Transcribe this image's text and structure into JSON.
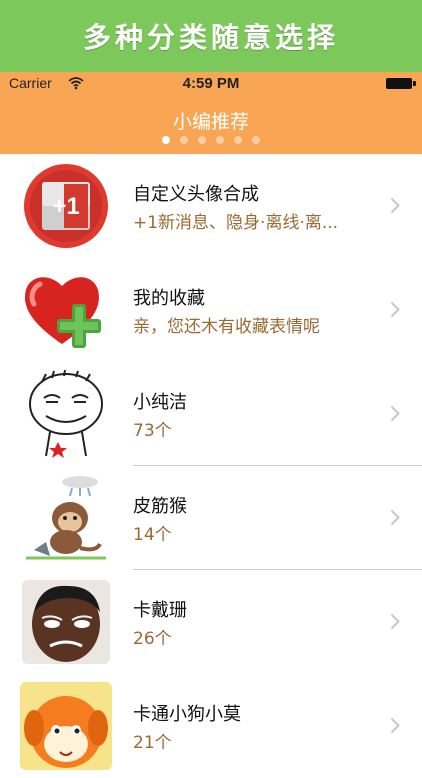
{
  "promo": {
    "text": "多种分类随意选择"
  },
  "status_bar": {
    "carrier": "Carrier",
    "time": "4:59 PM"
  },
  "nav": {
    "title": "小编推荐",
    "page_count": 6,
    "active_page": 1
  },
  "colors": {
    "promo_green": "#7cc85a",
    "header_orange": "#f9a654",
    "subtitle_brown": "#9b6a33"
  },
  "items": [
    {
      "title": "自定义头像合成",
      "subtitle": "+1新消息、隐身·离线·离...",
      "icon": "plus-one-badge-icon",
      "badge": "+1"
    },
    {
      "title": "我的收藏",
      "subtitle": "亲，您还木有收藏表情呢",
      "icon": "heart-plus-icon"
    },
    {
      "title": "小纯洁",
      "subtitle": "73个",
      "icon": "sketch-face-icon"
    },
    {
      "title": "皮筋猴",
      "subtitle": "14个",
      "icon": "monkey-icon"
    },
    {
      "title": "卡戴珊",
      "subtitle": "26个",
      "icon": "man-face-icon"
    },
    {
      "title": "卡通小狗小莫",
      "subtitle": "21个",
      "icon": "cartoon-dog-icon"
    }
  ]
}
